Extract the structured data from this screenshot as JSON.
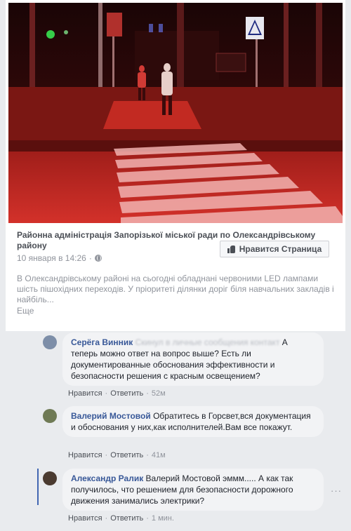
{
  "post": {
    "page_name": "Районна адміністрація Запорізької міської ради по Олександрівському району",
    "timestamp": "10 января в 14:26",
    "separator": "·",
    "like_page_label": "Нравится Страница",
    "text": "В Олександрівському районі на сьогодні обладнані червоними LED лампами шість пішохідних переходів. У пріоритеті ділянки доріг біля навчальних закладів і найбіль...",
    "more_label": "Еще"
  },
  "comments": [
    {
      "author": "Серёга Винник",
      "text": "А теперь можно ответ на вопрос выше? Есть ли документированные обоснования эффективности и безопасности решения с красным освещением?",
      "like_label": "Нравится",
      "reply_label": "Ответить",
      "time": "52м"
    },
    {
      "author": "Валерий Мостовой",
      "text": "Обратитесь в Горсвет,вся документация и обоснования у них,как исполнителей.Вам все покажут.",
      "like_label": "Нравится",
      "reply_label": "Ответить",
      "time": "41м"
    },
    {
      "author": "Александр Ралик",
      "mention": "Валерий Мостовой",
      "text": "эммм..... А как так получилось, что решением для безопасности дорожного движения занимались электрики?",
      "like_label": "Нравится",
      "reply_label": "Ответить",
      "time": "1 мин.",
      "options": "···"
    }
  ],
  "dot": "·",
  "icons": [
    "globe-icon",
    "thumbs-up-icon",
    "pedestrian-crossing-sign-icon"
  ],
  "colors": {
    "link": "#385898",
    "bubble": "#f2f3f5",
    "photo_tint": "#c0231e"
  }
}
